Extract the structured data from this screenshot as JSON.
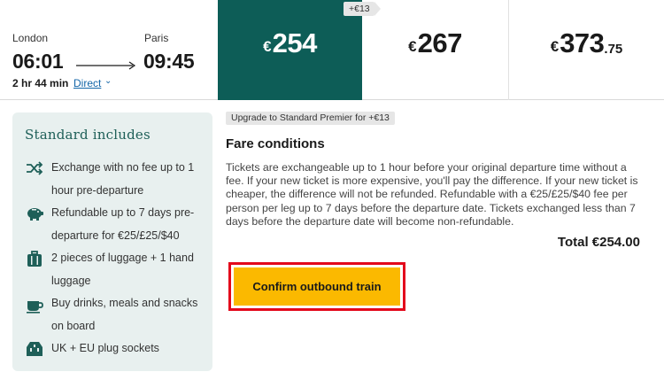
{
  "journey": {
    "from": "London",
    "to": "Paris",
    "departure": "06:01",
    "arrival": "09:45",
    "duration": "2 hr 44 min",
    "stops_link": "Direct"
  },
  "fares": [
    {
      "currency": "€",
      "amount": "254",
      "cents": "",
      "selected": true
    },
    {
      "currency": "€",
      "amount": "267",
      "cents": "",
      "selected": false
    },
    {
      "currency": "€",
      "amount": "373",
      "cents": ".75",
      "selected": false
    }
  ],
  "delta_badge": "+€13",
  "includes": {
    "title": "Standard includes",
    "items": [
      {
        "icon": "exchange-arrows-icon",
        "text": "Exchange with no fee up to 1 hour pre-departure"
      },
      {
        "icon": "piggy-bank-icon",
        "text": "Refundable up to 7 days pre-departure for €25/£25/$40"
      },
      {
        "icon": "luggage-icon",
        "text": "2 pieces of luggage + 1 hand luggage"
      },
      {
        "icon": "coffee-cup-icon",
        "text": "Buy drinks, meals and snacks on board"
      },
      {
        "icon": "plug-socket-icon",
        "text": "UK + EU plug sockets"
      }
    ]
  },
  "upgrade_badge": "Upgrade to Standard Premier for +€13",
  "fare_conditions": {
    "title": "Fare conditions",
    "body": "Tickets are exchangeable up to 1 hour before your original departure time without a fee. If your new ticket is more expensive, you'll pay the difference. If your new ticket is cheaper, the difference will not be refunded. Refundable with a €25/£25/$40 fee per person per leg up to 7 days before the departure date. Tickets exchanged less than 7 days before the departure date will become non-refundable."
  },
  "total": "Total €254.00",
  "confirm_button": "Confirm outbound train",
  "colors": {
    "selected_fare_bg": "#0d5d57",
    "includes_bg": "#e8f0ef",
    "confirm_bg": "#fbb900",
    "highlight_border": "#e3081b",
    "link": "#1366a8"
  }
}
